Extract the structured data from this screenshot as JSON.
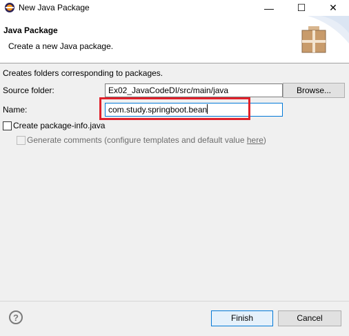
{
  "window": {
    "title": "New Java Package",
    "minimize_glyph": "—",
    "maximize_glyph": "☐",
    "close_glyph": "✕"
  },
  "banner": {
    "title": "Java Package",
    "description": "Create a new Java package."
  },
  "form": {
    "info": "Creates folders corresponding to packages.",
    "source_folder_label": "Source folder:",
    "source_folder_value": "Ex02_JavaCodeDI/src/main/java",
    "browse_label": "Browse...",
    "name_label": "Name:",
    "name_value": "com.study.springboot.bean",
    "package_info_label": "Create package-info.java",
    "package_info_checked": false,
    "generate_comments_label": "Generate comments",
    "generate_comments_hint_prefix": "(configure templates and default value ",
    "generate_comments_link": "here",
    "generate_comments_hint_suffix": ")",
    "generate_comments_enabled": false
  },
  "footer": {
    "help_glyph": "?",
    "finish_label": "Finish",
    "cancel_label": "Cancel"
  },
  "colors": {
    "highlight": "#e0202a",
    "focus_border": "#0078d7",
    "package_icon": "#c89b6b"
  }
}
